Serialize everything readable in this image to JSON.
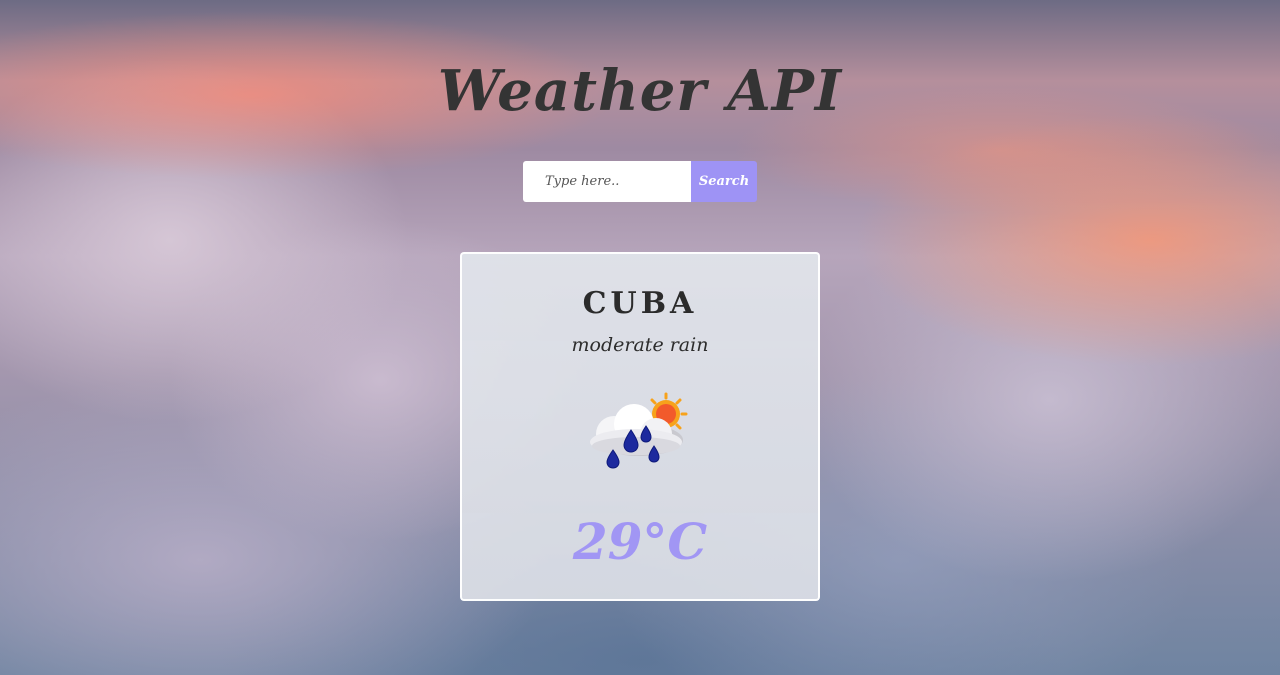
{
  "header": {
    "title": "Weather API"
  },
  "search": {
    "placeholder": "Type here..",
    "value": "",
    "button_label": "Search"
  },
  "weather": {
    "city": "CUBA",
    "description": "moderate rain",
    "icon": "rain-cloud-sun-icon",
    "temperature": "29°C"
  },
  "colors": {
    "accent": "#9e93f5",
    "temperature": "#a196f4",
    "title": "#343434"
  }
}
